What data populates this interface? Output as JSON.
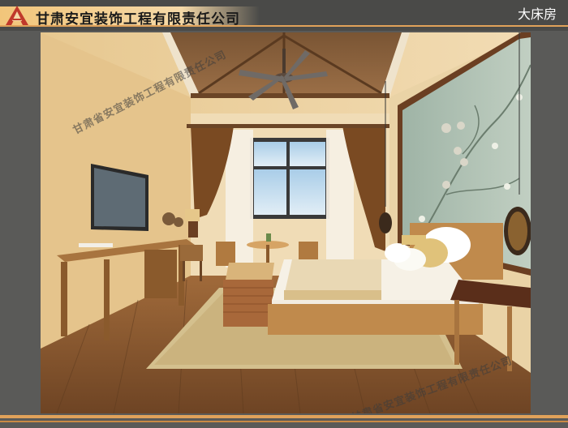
{
  "header": {
    "company_name": "甘肃安宜装饰工程有限责任公司",
    "room_name": "大床房"
  },
  "watermarks": {
    "top_left": "甘肃省安宜装饰工程有限责任公司",
    "bottom_right": "甘肃省安宜装饰工程有限责任公司"
  },
  "colors": {
    "background": "#5a5a58",
    "accent_orange": "#e0a25a",
    "header_strip": "#f2c57a",
    "wall": "#ead3a6",
    "floor": "#8a5a32"
  },
  "icons": {
    "logo": "company-logo-icon"
  }
}
